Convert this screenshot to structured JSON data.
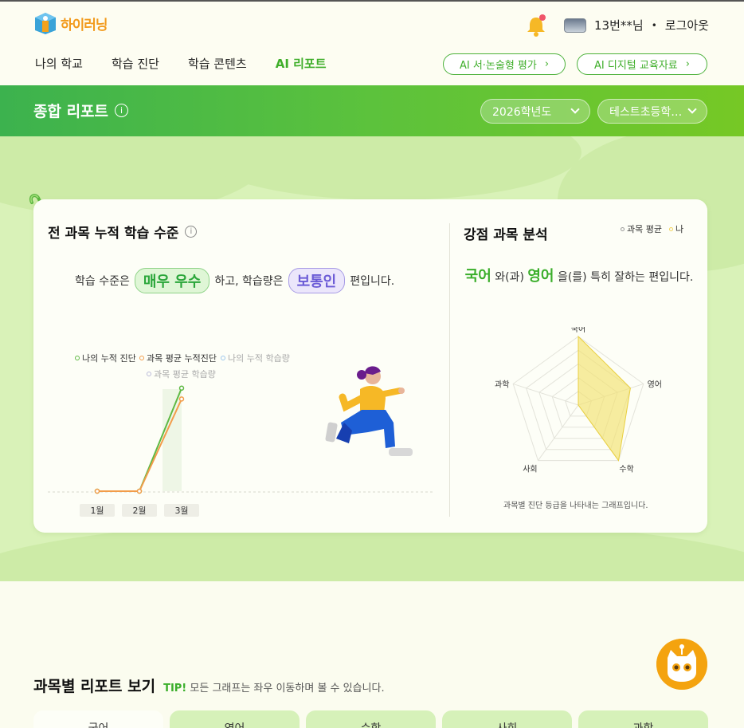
{
  "header": {
    "logo_text": "하이러닝",
    "user_name": "13번**님",
    "separator": "•",
    "logout": "로그아웃",
    "nav": [
      "나의 학교",
      "학습 진단",
      "학습 콘텐츠",
      "AI 리포트"
    ],
    "active_nav": "AI 리포트",
    "btn_essay": "AI 서·논술형 평가",
    "btn_digital": "AI 디지털 교육자료"
  },
  "banner": {
    "title": "종합 리포트",
    "year_select": "2026학년도",
    "school_select": "테스트초등학…"
  },
  "cumulative": {
    "title": "전 과목 누적 학습 수준",
    "sentence_prefix": "학습 수준은",
    "level": "매우 우수",
    "sentence_middle": "하고, 학습량은",
    "amount": "보통인",
    "sentence_suffix": "편입니다.",
    "legend": [
      "나의 누적 진단",
      "과목 평균 누적진단",
      "나의 누적 학습량",
      "과목 평균 학습량"
    ],
    "colors": {
      "mine": "#5fb944",
      "avg": "#f29c4a",
      "my_amount": "#9cc6ec",
      "avg_amount": "#b9b9d8"
    }
  },
  "strength": {
    "title": "강점 과목 분석",
    "legend": [
      "과목 평균",
      "나"
    ],
    "subject1": "국어",
    "text1": "와(과)",
    "subject2": "영어",
    "text2": "을(를) 특히 잘하는 편입니다.",
    "caption": "과목별 진단 등급을 나타내는 그래프입니다."
  },
  "subject_report": {
    "title": "과목별 리포트 보기",
    "tip_label": "TIP!",
    "tip_text": "모든 그래프는 좌우 이동하며 볼 수 있습니다.",
    "tabs": [
      "국어",
      "영어",
      "수학",
      "사회",
      "과학"
    ]
  },
  "chart_data": [
    {
      "type": "line",
      "x": [
        "1월",
        "2월",
        "3월"
      ],
      "series": [
        {
          "name": "나의 누적 진단",
          "values": [
            0,
            0,
            95
          ]
        },
        {
          "name": "과목 평균 누적진단",
          "values": [
            0,
            0,
            85
          ]
        }
      ]
    },
    {
      "type": "radar",
      "categories": [
        "국어",
        "영어",
        "수학",
        "사회",
        "과학"
      ],
      "series": [
        {
          "name": "나",
          "values": [
            1.0,
            0.8,
            1.0,
            0.0,
            0.0
          ]
        },
        {
          "name": "과목 평균",
          "values": [
            0,
            0,
            0,
            0,
            0
          ]
        }
      ]
    }
  ]
}
